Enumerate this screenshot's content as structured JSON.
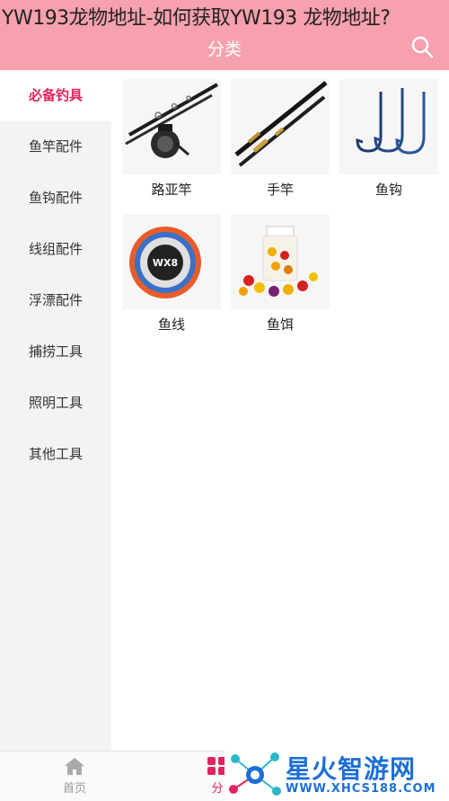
{
  "overlay": {
    "title_line": "YW193龙物地址-如何获取YW193 龙物地址?"
  },
  "header": {
    "title": "分类",
    "search_icon": "search-icon"
  },
  "sidebar": {
    "items": [
      {
        "label": "必备钓具",
        "active": true
      },
      {
        "label": "鱼竿配件",
        "active": false
      },
      {
        "label": "鱼钩配件",
        "active": false
      },
      {
        "label": "线组配件",
        "active": false
      },
      {
        "label": "浮漂配件",
        "active": false
      },
      {
        "label": "捕捞工具",
        "active": false
      },
      {
        "label": "照明工具",
        "active": false
      },
      {
        "label": "其他工具",
        "active": false
      }
    ]
  },
  "products": [
    {
      "label": "路亚竿",
      "icon": "lure-rod-image"
    },
    {
      "label": "手竿",
      "icon": "hand-rod-image"
    },
    {
      "label": "鱼钩",
      "icon": "fish-hook-image"
    },
    {
      "label": "鱼线",
      "icon": "fishing-line-image"
    },
    {
      "label": "鱼饵",
      "icon": "fish-bait-image"
    }
  ],
  "tabbar": {
    "items": [
      {
        "label": "首页",
        "icon": "home-icon"
      },
      {
        "label": "分",
        "icon": "category-icon"
      }
    ]
  },
  "watermark": {
    "text": "星火智游网",
    "url": "WWW.XHCS188.COM"
  },
  "colors": {
    "header": "#f7a1ae",
    "accent": "#e4245c",
    "sidebar": "#f3f3f3"
  }
}
